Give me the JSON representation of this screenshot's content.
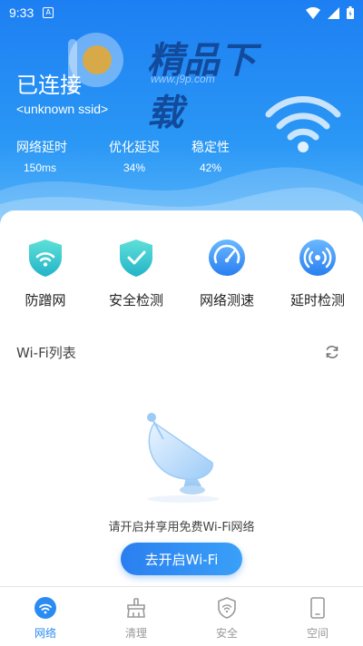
{
  "status_bar": {
    "time": "9:33",
    "notification_letter": "A"
  },
  "watermark": {
    "brand": "精品下载",
    "url": "www.j9p.com"
  },
  "connection": {
    "title": "已连接",
    "ssid": "<unknown ssid>"
  },
  "stats": [
    {
      "label": "网络延时",
      "value": "150ms"
    },
    {
      "label": "优化延迟",
      "value": "34%"
    },
    {
      "label": "稳定性",
      "value": "42%"
    }
  ],
  "tools": [
    {
      "label": "防蹭网",
      "icon": "shield-wifi-icon"
    },
    {
      "label": "安全检测",
      "icon": "shield-check-icon"
    },
    {
      "label": "网络测速",
      "icon": "speedometer-icon"
    },
    {
      "label": "延时检测",
      "icon": "signal-broadcast-icon"
    }
  ],
  "wifi_list": {
    "title": "Wi-Fi列表",
    "empty_text": "请开启并享用免费Wi-Fi网络",
    "button": "去开启Wi-Fi"
  },
  "nav": [
    {
      "label": "网络",
      "icon": "wifi-icon",
      "active": true
    },
    {
      "label": "清理",
      "icon": "broom-icon",
      "active": false
    },
    {
      "label": "安全",
      "icon": "shield-icon",
      "active": false
    },
    {
      "label": "空间",
      "icon": "phone-icon",
      "active": false
    }
  ],
  "colors": {
    "primary": "#2a8bf2",
    "header_top": "#1d7ff2",
    "inactive": "#999999"
  }
}
